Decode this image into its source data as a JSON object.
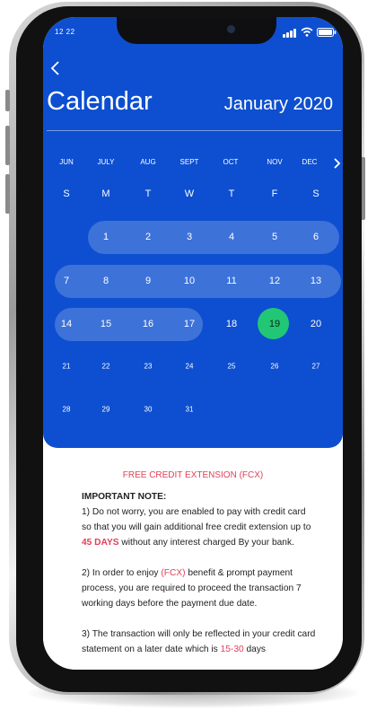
{
  "status_bar": {
    "time": "12 22"
  },
  "header": {
    "title": "Calendar",
    "month_year": "January 2020"
  },
  "months": [
    "JUN",
    "JULY",
    "AUG",
    "SEPT",
    "OCT",
    "NOV",
    "DEC"
  ],
  "weekdays": [
    "S",
    "M",
    "T",
    "W",
    "T",
    "F",
    "S"
  ],
  "calendar": {
    "weeks": [
      [
        "",
        "1",
        "2",
        "3",
        "4",
        "5",
        "6"
      ],
      [
        "7",
        "8",
        "9",
        "10",
        "11",
        "12",
        "13"
      ],
      [
        "14",
        "15",
        "16",
        "17",
        "18",
        "19",
        "20"
      ],
      [
        "21",
        "22",
        "23",
        "24",
        "25",
        "26",
        "27"
      ],
      [
        "28",
        "29",
        "30",
        "31",
        "",
        "",
        ""
      ]
    ],
    "selected_day": "19"
  },
  "info": {
    "heading": "FREE CREDIT EXTENSION (FCX)",
    "note_title": "IMPORTANT NOTE:",
    "p1_a": "1) Do not worry, you are enabled to pay with credit card so that you will gain additional free credit extension up to ",
    "p1_hl": "45 DAYS",
    "p1_b": " without any interest charged By your bank.",
    "p2_a": "2) In order to enjoy ",
    "p2_hl": "(FCX)",
    "p2_b": " benefit & prompt payment process, you are required to proceed the transaction 7 working days before the payment due date.",
    "p3_a": "3) The transaction will only be reflected in your credit card statement on a later date which is ",
    "p3_hl": "15-30",
    "p3_b": " days"
  },
  "colors": {
    "primary": "#0d4fd0",
    "accent_red": "#e0405a",
    "today_green": "#22c775"
  }
}
